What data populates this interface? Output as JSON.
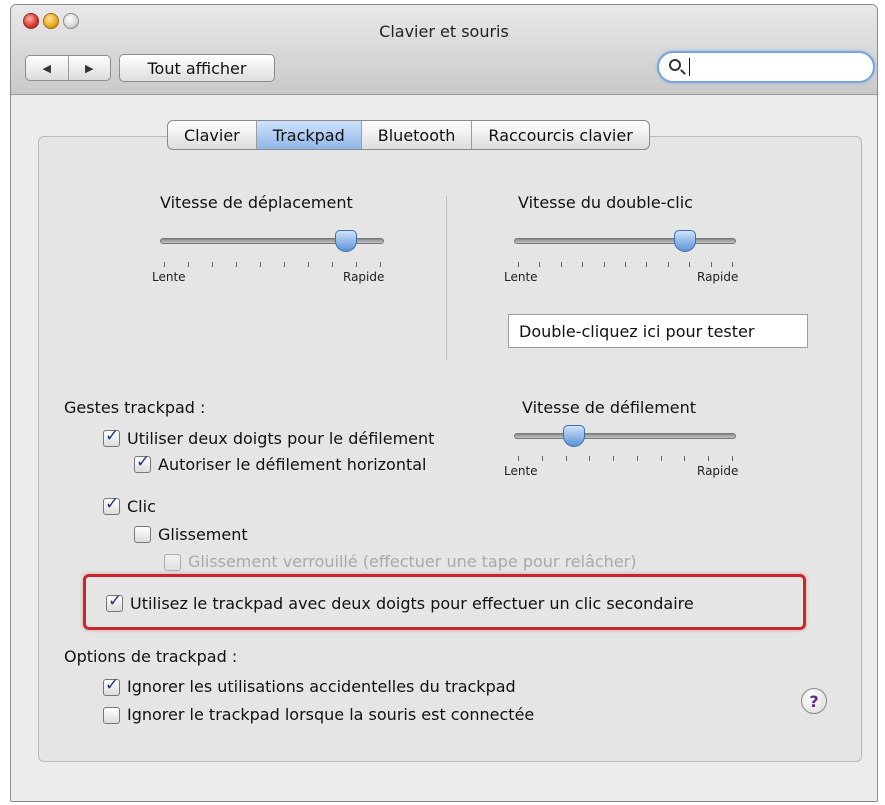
{
  "window": {
    "title": "Clavier et souris"
  },
  "toolbar": {
    "back_icon": "triangle-left",
    "forward_icon": "triangle-right",
    "show_all_label": "Tout afficher",
    "search": {
      "value": "",
      "placeholder": "",
      "icon": "magnifier-icon"
    }
  },
  "tabs": [
    {
      "label": "Clavier",
      "active": false
    },
    {
      "label": "Trackpad",
      "active": true
    },
    {
      "label": "Bluetooth",
      "active": false
    },
    {
      "label": "Raccourcis clavier",
      "active": false
    }
  ],
  "tracking_speed": {
    "title": "Vitesse de déplacement",
    "min_label": "Lente",
    "max_label": "Rapide",
    "value": 0.83
  },
  "double_click_speed": {
    "title": "Vitesse du double-clic",
    "min_label": "Lente",
    "max_label": "Rapide",
    "value": 0.77,
    "test_area_label": "Double-cliquez ici pour tester"
  },
  "gestures": {
    "heading": "Gestes trackpad :",
    "two_finger_scroll": {
      "label": "Utiliser deux doigts pour le défilement",
      "checked": true
    },
    "horizontal_scroll": {
      "label": "Autoriser le défilement horizontal",
      "checked": true
    },
    "click": {
      "label": "Clic",
      "checked": true
    },
    "drag": {
      "label": "Glissement",
      "checked": false
    },
    "drag_lock": {
      "label": "Glissement verrouillé (effectuer une tape pour relâcher)",
      "checked": false,
      "enabled": false
    },
    "secondary_click": {
      "label": "Utilisez le trackpad avec deux doigts pour effectuer un clic secondaire",
      "checked": true
    }
  },
  "scroll_speed": {
    "title": "Vitesse de défilement",
    "min_label": "Lente",
    "max_label": "Rapide",
    "value": 0.27
  },
  "options": {
    "heading": "Options de trackpad :",
    "ignore_accidental": {
      "label": "Ignorer les utilisations accidentelles du trackpad",
      "checked": true
    },
    "ignore_with_mouse": {
      "label": "Ignorer le trackpad lorsque la souris est connectée",
      "checked": false
    }
  },
  "help": {
    "label": "?"
  },
  "colors": {
    "accent": "#5c93d6",
    "highlight_border": "#c9252b"
  }
}
